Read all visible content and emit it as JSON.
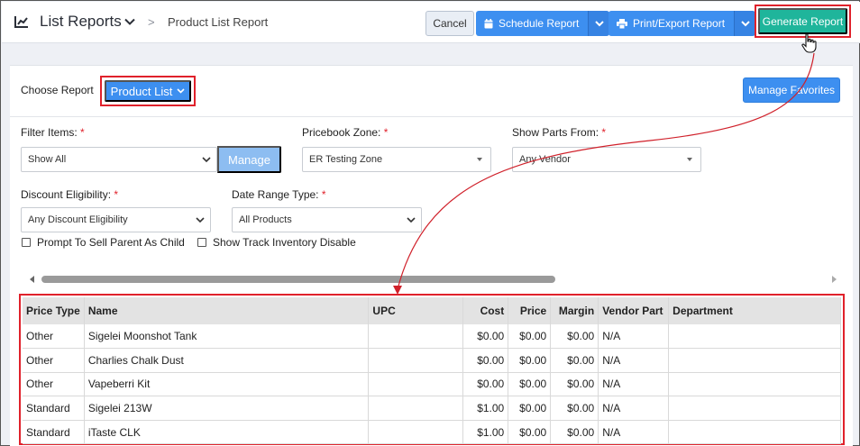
{
  "header": {
    "app_title": "List Reports",
    "breadcrumb_separator": ">",
    "breadcrumb": "Product List Report",
    "cancel_label": "Cancel",
    "schedule_label": "Schedule Report",
    "print_export_label": "Print/Export Report",
    "generate_label": "Generate Report"
  },
  "report": {
    "choose_label": "Choose Report",
    "selected_report": "Product List",
    "manage_favorites_label": "Manage Favorites"
  },
  "filters": {
    "filter_items": {
      "label": "Filter Items:",
      "required": "*",
      "value": "Show All",
      "manage_label": "Manage"
    },
    "pricebook_zone": {
      "label": "Pricebook Zone:",
      "required": "*",
      "value": "ER Testing Zone"
    },
    "show_parts_from": {
      "label": "Show Parts From:",
      "required": "*",
      "value": "Any Vendor"
    },
    "discount_eligibility": {
      "label": "Discount Eligibility:",
      "required": "*",
      "value": "Any Discount Eligibility"
    },
    "date_range_type": {
      "label": "Date Range Type:",
      "required": "*",
      "value": "All Products"
    },
    "prompt_parent": {
      "label": "Prompt To Sell Parent As Child",
      "checked": false
    },
    "track_inventory": {
      "label": "Show Track Inventory Disable",
      "checked": false
    }
  },
  "table": {
    "columns": [
      "Price Type",
      "Name",
      "UPC",
      "Cost",
      "Price",
      "Margin",
      "Vendor Part",
      "Department"
    ],
    "rows": [
      [
        "Other",
        "Sigelei Moonshot Tank",
        "",
        "$0.00",
        "$0.00",
        "$0.00",
        "N/A",
        ""
      ],
      [
        "Other",
        "Charlies Chalk Dust",
        "",
        "$0.00",
        "$0.00",
        "$0.00",
        "N/A",
        ""
      ],
      [
        "Other",
        "Vapeberri Kit",
        "",
        "$0.00",
        "$0.00",
        "$0.00",
        "N/A",
        ""
      ],
      [
        "Standard",
        "Sigelei 213W",
        "",
        "$1.00",
        "$0.00",
        "$0.00",
        "N/A",
        ""
      ],
      [
        "Standard",
        "iTaste CLK",
        "",
        "$1.00",
        "$0.00",
        "$0.00",
        "N/A",
        ""
      ]
    ]
  },
  "colors": {
    "primary_blue": "#3d8ff0",
    "generate_teal": "#1fb59b",
    "highlight_red": "#e0212b",
    "manage_light_blue": "#8dbdf1"
  }
}
